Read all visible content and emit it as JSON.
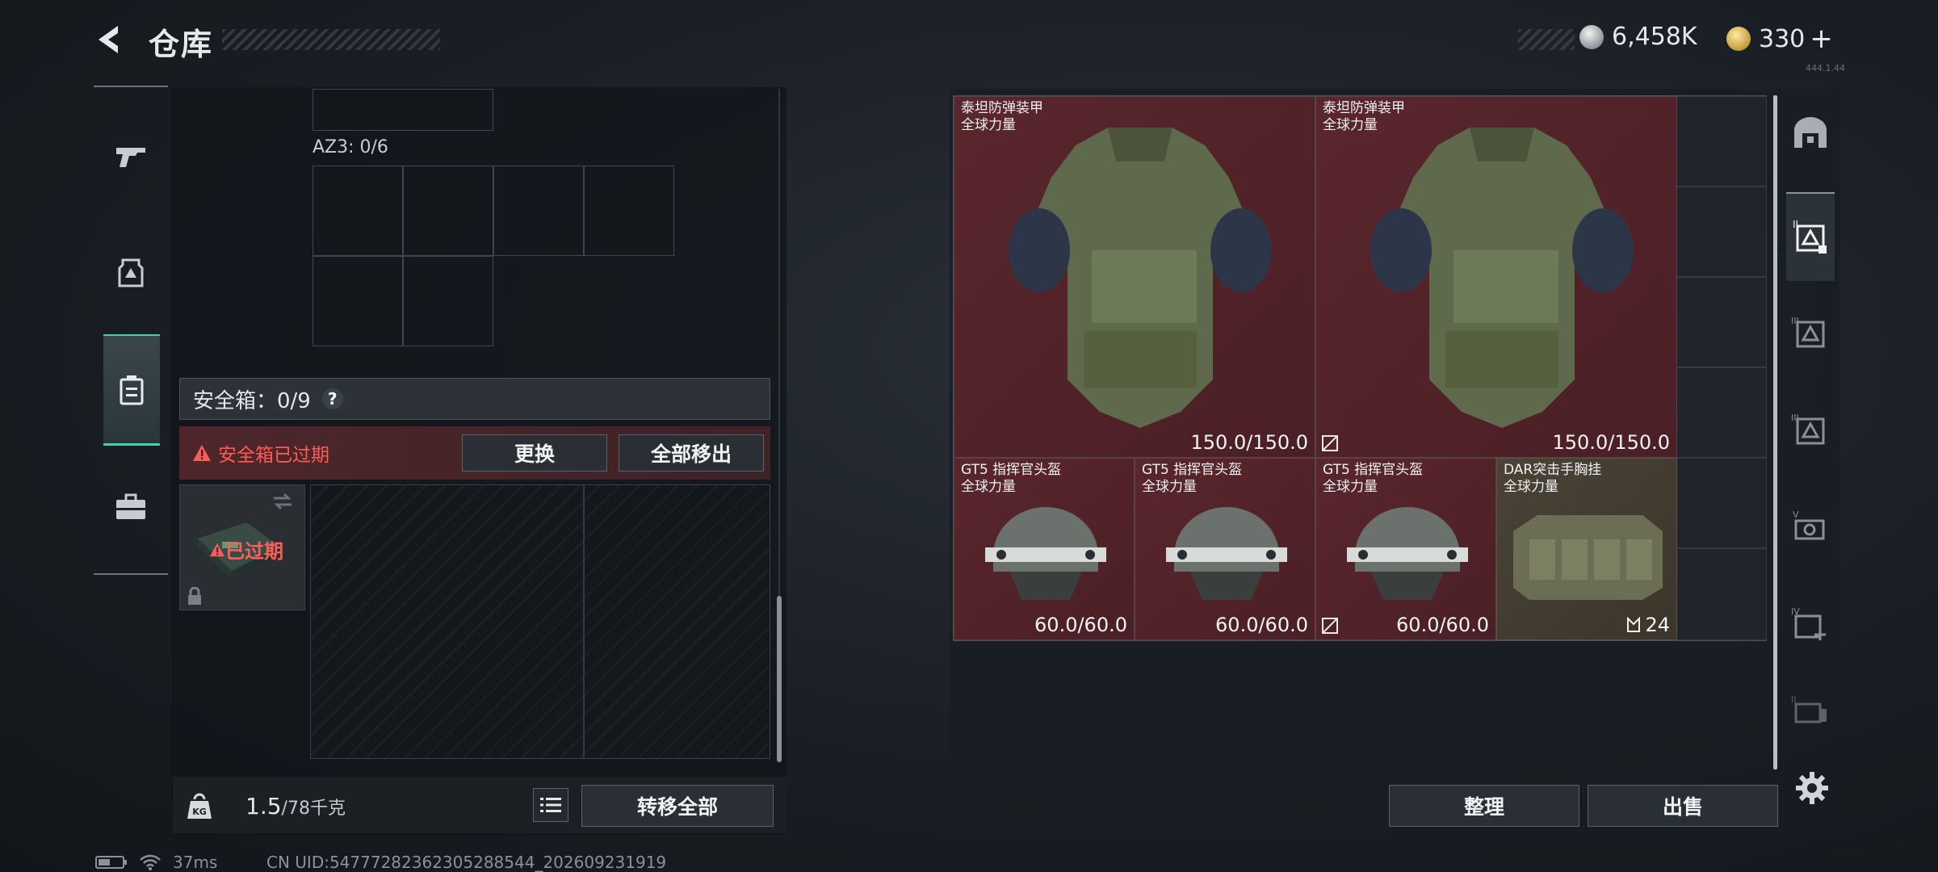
{
  "header": {
    "title": "仓库",
    "currency_primary": "6,458K",
    "currency_secondary": "330",
    "currency_secondary_plus": "+",
    "version": "444.1.44"
  },
  "left_nav": {
    "items": [
      "weapon-icon",
      "armor-icon",
      "backpack-icon",
      "toolbox-icon"
    ],
    "active_index": 2
  },
  "container": {
    "az3_label": "AZ3: 0/6",
    "safe_box_label": "安全箱：0/9",
    "safe_box_help": "?",
    "expired_warning": "安全箱已过期",
    "replace_button": "更换",
    "move_all_button": "全部移出",
    "case_expired_tag": "已过期"
  },
  "weight": {
    "current": "1.5",
    "max": "/78千克",
    "transfer_all_button": "转移全部"
  },
  "items": [
    {
      "name": "泰坦防弹装甲",
      "brand": "全球力量",
      "value": "150.0/150.0",
      "color": "red"
    },
    {
      "name": "泰坦防弹装甲",
      "brand": "全球力量",
      "value": "150.0/150.0",
      "color": "red"
    },
    {
      "name": "GT5 指挥官头盔",
      "brand": "全球力量",
      "value": "60.0/60.0",
      "color": "red"
    },
    {
      "name": "GT5 指挥官头盔",
      "brand": "全球力量",
      "value": "60.0/60.0",
      "color": "red"
    },
    {
      "name": "GT5 指挥官头盔",
      "brand": "全球力量",
      "value": "60.0/60.0",
      "color": "red"
    },
    {
      "name": "DAR突击手胸挂",
      "brand": "全球力量",
      "value": "24",
      "color": "tan"
    }
  ],
  "actions": {
    "sort_button": "整理",
    "sell_button": "出售"
  },
  "side_tabs": [
    "storage-home-icon",
    "tab-II-icon",
    "tab-III-icon",
    "tab-III-b-icon",
    "tab-V-icon",
    "tab-IV-icon",
    "tab-extra-icon"
  ],
  "status": {
    "ping": "37ms",
    "uid": "CN UID:5477728236230528854​4_202609231919"
  }
}
